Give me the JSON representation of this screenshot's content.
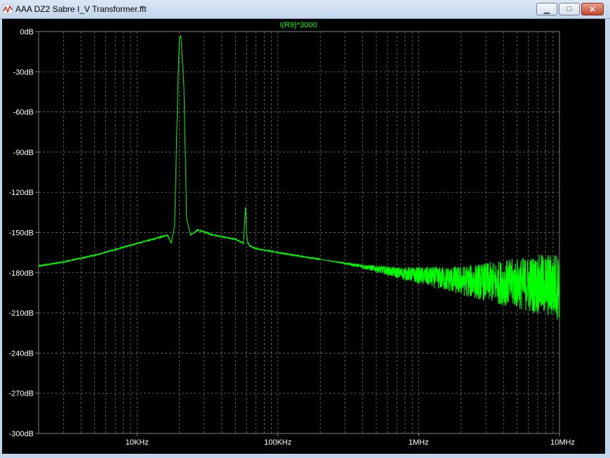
{
  "window": {
    "title": "AAA DZ2 Sabre I_V Transformer.fft",
    "minimize_label": "▁",
    "maximize_label": "□",
    "close_label": "✕"
  },
  "chart_data": {
    "type": "line",
    "title": "I(R9)*3000",
    "series": [
      {
        "name": "I(R9)*3000",
        "color": "#00ff00",
        "x": [
          2000,
          3000,
          5000,
          8000,
          12000,
          15000,
          16500,
          17500,
          18500,
          19500,
          20000,
          20500,
          21500,
          22500,
          24000,
          27000,
          35000,
          50000,
          57000,
          59000,
          60000,
          61000,
          63000,
          70000,
          100000,
          150000,
          200000,
          300000,
          500000,
          700000,
          1000000,
          2000000,
          5000000,
          10000000
        ],
        "y": [
          -175,
          -172,
          -167,
          -161,
          -156,
          -153,
          -152,
          -158,
          -145,
          -40,
          -5,
          -3,
          -40,
          -140,
          -152,
          -148,
          -152,
          -155,
          -158,
          -130,
          -150,
          -157,
          -160,
          -162,
          -165,
          -168,
          -170,
          -173,
          -177,
          -180,
          -182,
          -186,
          -188,
          -190
        ]
      }
    ],
    "noise_floor_note_start_hz": 200000,
    "x_scale": "log",
    "xlim": [
      2000,
      10000000
    ],
    "ylim": [
      -300,
      0
    ],
    "x_ticks": [
      {
        "value": 10000,
        "label": "10KHz"
      },
      {
        "value": 100000,
        "label": "100KHz"
      },
      {
        "value": 1000000,
        "label": "1MHz"
      },
      {
        "value": 10000000,
        "label": "10MHz"
      }
    ],
    "y_ticks": [
      {
        "value": 0,
        "label": "0dB"
      },
      {
        "value": -30,
        "label": "-30dB"
      },
      {
        "value": -60,
        "label": "-60dB"
      },
      {
        "value": -90,
        "label": "-90dB"
      },
      {
        "value": -120,
        "label": "-120dB"
      },
      {
        "value": -150,
        "label": "-150dB"
      },
      {
        "value": -180,
        "label": "-180dB"
      },
      {
        "value": -210,
        "label": "-210dB"
      },
      {
        "value": -240,
        "label": "-240dB"
      },
      {
        "value": -270,
        "label": "-270dB"
      },
      {
        "value": -300,
        "label": "-300dB"
      }
    ],
    "grid": true,
    "background": "#000000",
    "axis_color": "#808080",
    "grid_color": "#808080",
    "title_color": "#00ff00"
  }
}
